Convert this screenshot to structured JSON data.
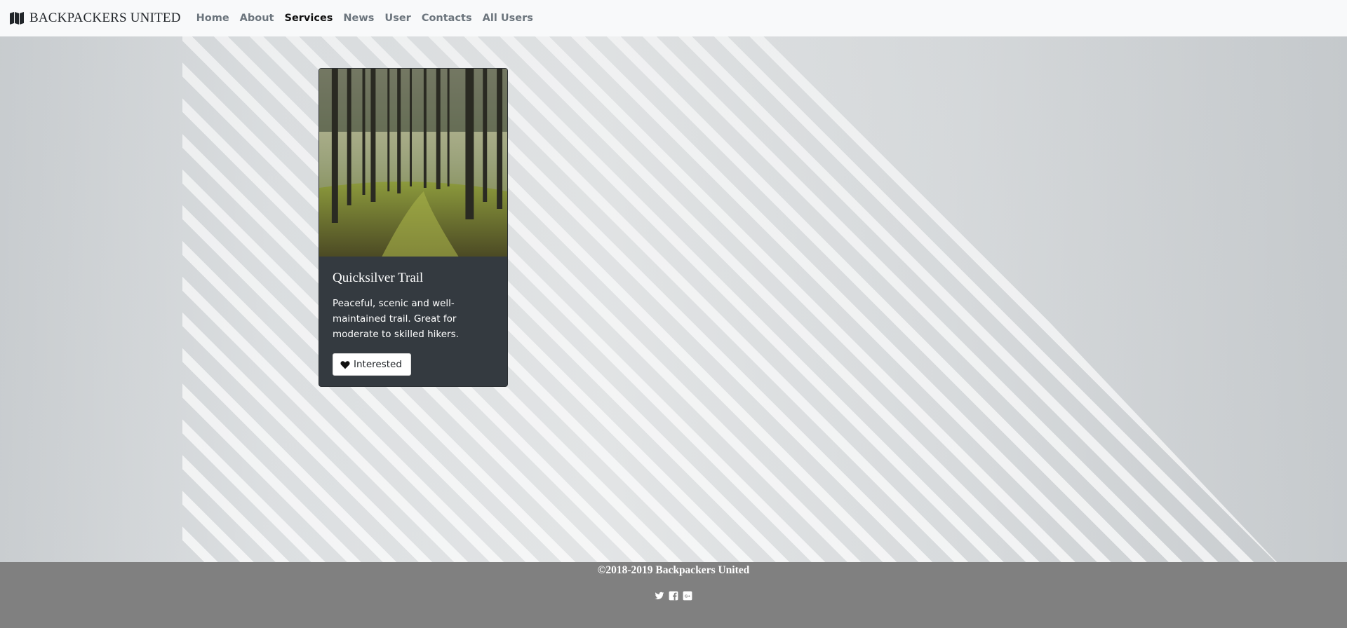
{
  "navbar": {
    "brand": "BACKPACKERS UNITED",
    "brand_icon": "map-icon",
    "links": [
      "Home",
      "About",
      "Services",
      "News",
      "User",
      "Contacts",
      "All Users"
    ],
    "active": "Services"
  },
  "card": {
    "image_alt": "forest trail",
    "title": "Quicksilver Trail",
    "text": "Peaceful, scenic and well-maintained trail. Great for moderate to skilled hikers.",
    "button_label": "Interested",
    "button_icon": "heart-icon"
  },
  "footer": {
    "copyright": "©2018-2019 Backpackers United",
    "social_icons": [
      "twitter-icon",
      "facebook-icon",
      "google-plus-icon"
    ]
  },
  "colors": {
    "navbar_bg": "#f8f9fa",
    "card_bg": "#343a40",
    "footer_bg": "#808080",
    "active_link": "#111111",
    "inactive_link": "#6c757d"
  }
}
